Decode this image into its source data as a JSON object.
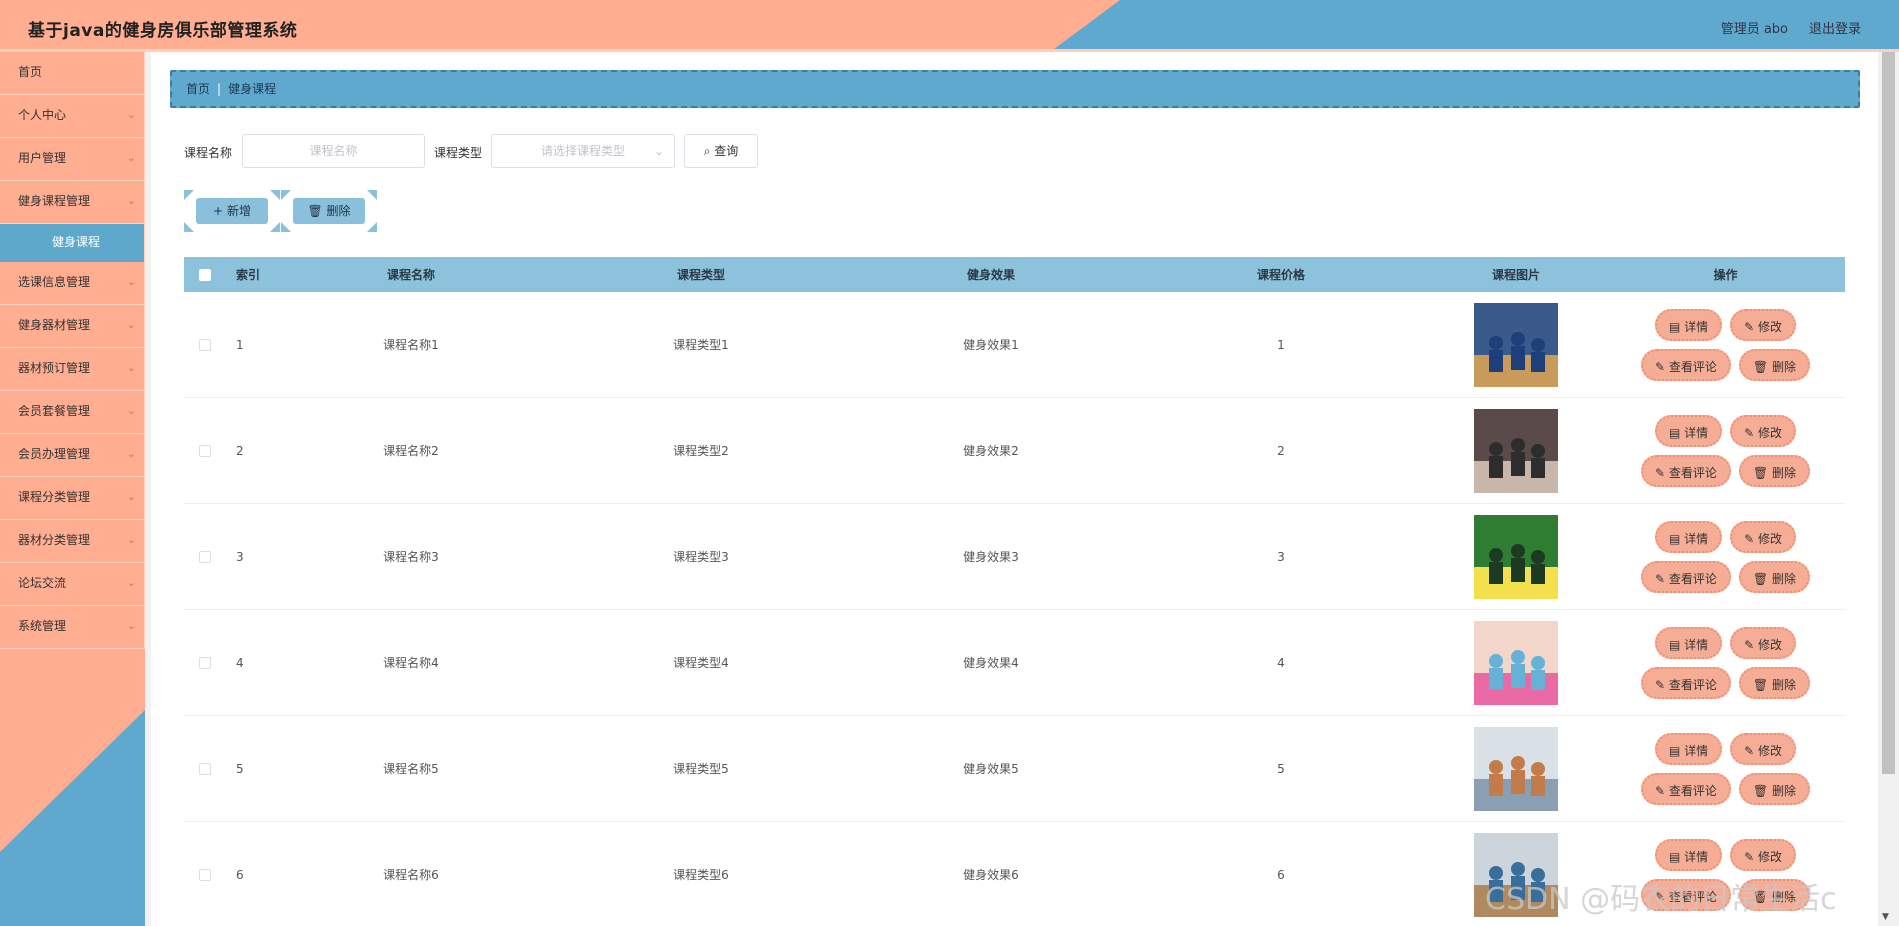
{
  "app": {
    "title": "基于java的健身房俱乐部管理系统",
    "user_label": "管理员 abo",
    "logout_label": "退出登录"
  },
  "colors": {
    "accent_blue": "#5fa9cf",
    "accent_salmon": "#ffae91",
    "table_header": "#8cc2db"
  },
  "sidebar": {
    "items": [
      {
        "label": "首页",
        "expandable": false
      },
      {
        "label": "个人中心",
        "expandable": true
      },
      {
        "label": "用户管理",
        "expandable": true
      },
      {
        "label": "健身课程管理",
        "expandable": true
      },
      {
        "label": "健身课程",
        "sub": true
      },
      {
        "label": "选课信息管理",
        "expandable": true
      },
      {
        "label": "健身器材管理",
        "expandable": true
      },
      {
        "label": "器材预订管理",
        "expandable": true
      },
      {
        "label": "会员套餐管理",
        "expandable": true
      },
      {
        "label": "会员办理管理",
        "expandable": true
      },
      {
        "label": "课程分类管理",
        "expandable": true
      },
      {
        "label": "器材分类管理",
        "expandable": true
      },
      {
        "label": "论坛交流",
        "expandable": true
      },
      {
        "label": "系统管理",
        "expandable": true
      }
    ]
  },
  "breadcrumb": {
    "home": "首页",
    "current": "健身课程"
  },
  "search": {
    "name_label": "课程名称",
    "name_placeholder": "课程名称",
    "type_label": "课程类型",
    "type_placeholder": "请选择课程类型",
    "query_label": "查询"
  },
  "actions": {
    "add_label": "新增",
    "delete_label": "删除"
  },
  "table": {
    "headers": {
      "index": "索引",
      "name": "课程名称",
      "type": "课程类型",
      "effect": "健身效果",
      "price": "课程价格",
      "image": "课程图片",
      "ops": "操作"
    },
    "rows": [
      {
        "index": "1",
        "name": "课程名称1",
        "type": "课程类型1",
        "effect": "健身效果1",
        "price": "1"
      },
      {
        "index": "2",
        "name": "课程名称2",
        "type": "课程类型2",
        "effect": "健身效果2",
        "price": "2"
      },
      {
        "index": "3",
        "name": "课程名称3",
        "type": "课程类型3",
        "effect": "健身效果3",
        "price": "3"
      },
      {
        "index": "4",
        "name": "课程名称4",
        "type": "课程类型4",
        "effect": "健身效果4",
        "price": "4"
      },
      {
        "index": "5",
        "name": "课程名称5",
        "type": "课程类型5",
        "effect": "健身效果5",
        "price": "5"
      },
      {
        "index": "6",
        "name": "课程名称6",
        "type": "课程类型6",
        "effect": "健身效果6",
        "price": "6"
      }
    ],
    "row_ops": {
      "detail": "详情",
      "edit": "修改",
      "comments": "查看评论",
      "delete": "删除"
    }
  },
  "watermark": "CSDN @码农的日常生活c"
}
